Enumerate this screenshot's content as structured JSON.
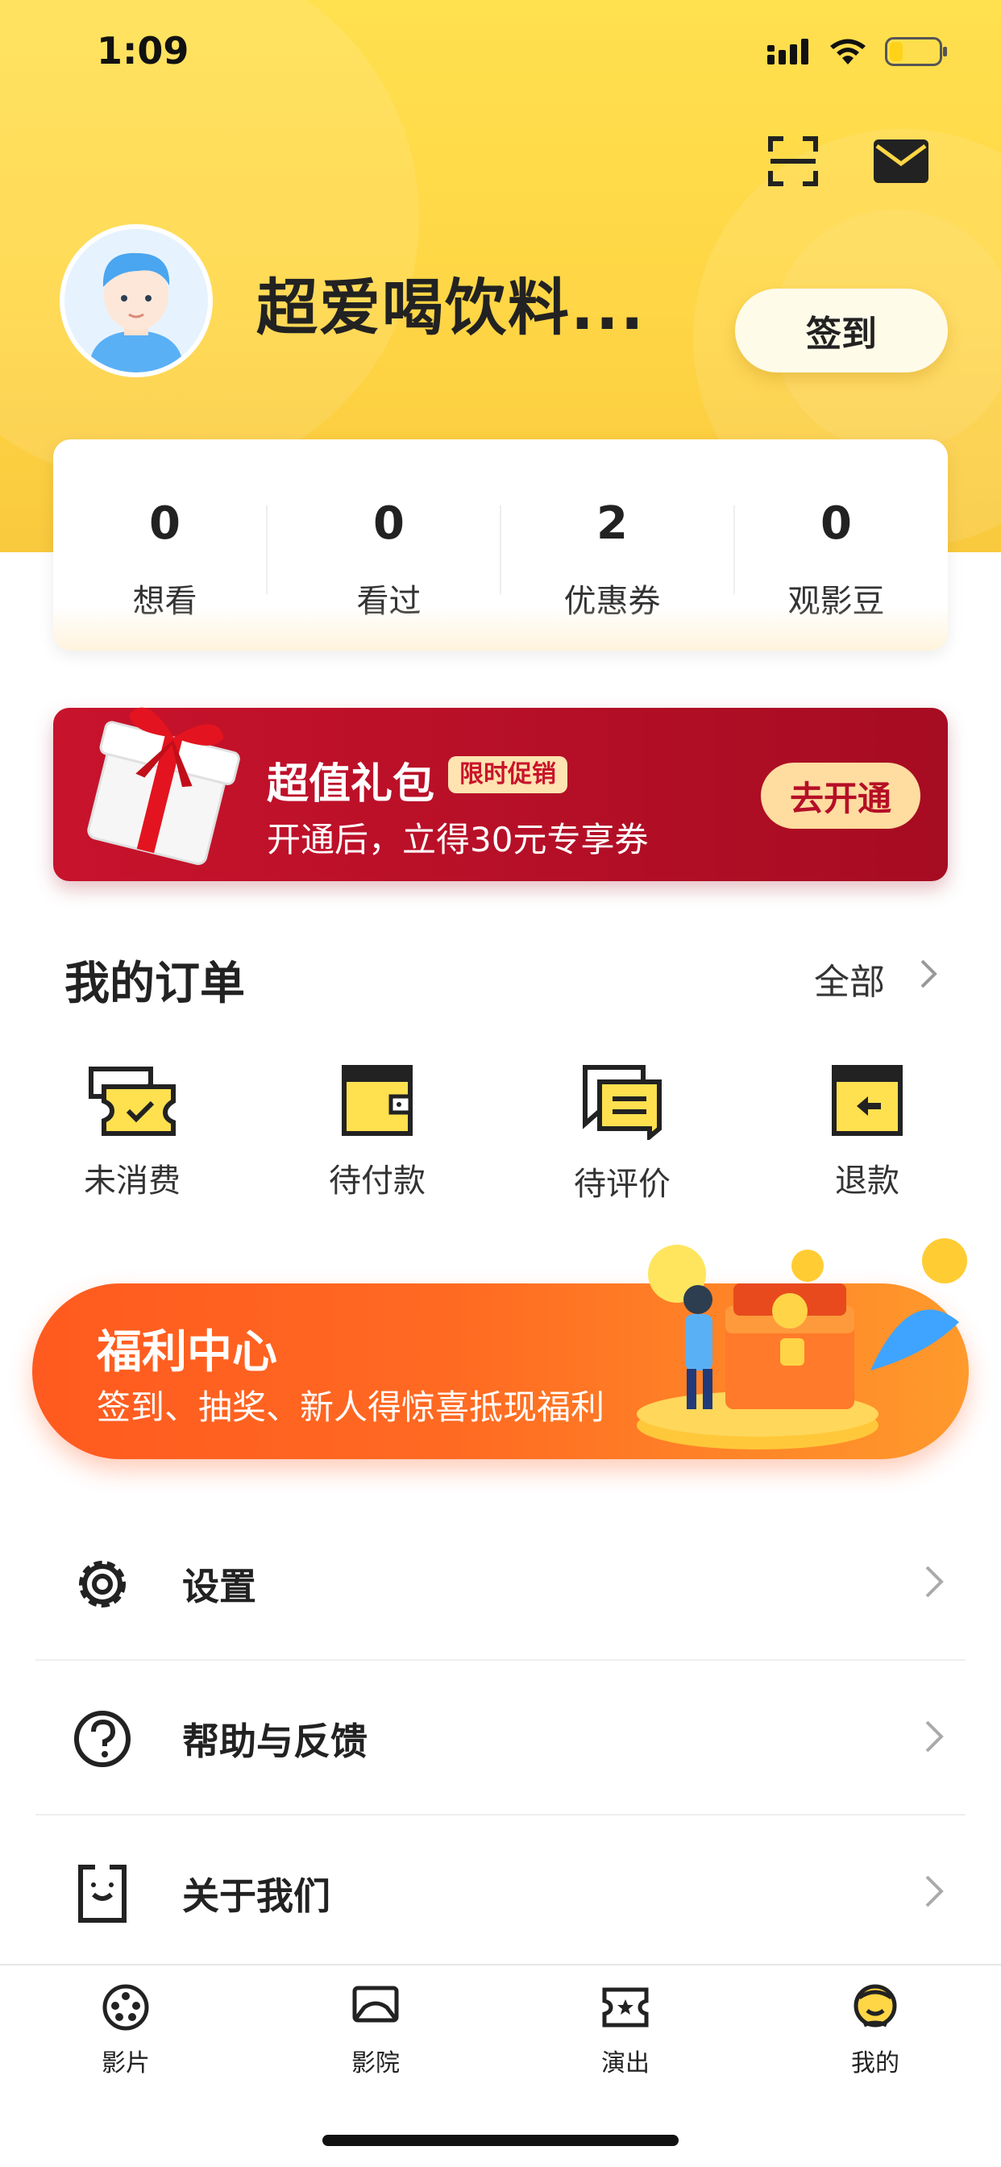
{
  "status_bar": {
    "time": "1:09"
  },
  "profile": {
    "username": "超爱喝饮料...",
    "signin_label": "签到"
  },
  "stats": [
    {
      "value": "0",
      "label": "想看"
    },
    {
      "value": "0",
      "label": "看过"
    },
    {
      "value": "2",
      "label": "优惠券"
    },
    {
      "value": "0",
      "label": "观影豆"
    }
  ],
  "promo": {
    "title": "超值礼包",
    "tag": "限时促销",
    "subtitle": "开通后，立得30元专享券",
    "button": "去开通"
  },
  "orders": {
    "title": "我的订单",
    "see_all": "全部",
    "items": [
      {
        "label": "未消费",
        "icon": "ticket-check-icon"
      },
      {
        "label": "待付款",
        "icon": "wallet-icon"
      },
      {
        "label": "待评价",
        "icon": "comment-icon"
      },
      {
        "label": "退款",
        "icon": "refund-icon"
      }
    ]
  },
  "welfare": {
    "title": "福利中心",
    "subtitle": "签到、抽奖、新人得惊喜抵现福利"
  },
  "menu": [
    {
      "label": "设置",
      "icon": "gear-icon"
    },
    {
      "label": "帮助与反馈",
      "icon": "help-icon"
    },
    {
      "label": "关于我们",
      "icon": "about-icon"
    }
  ],
  "tabbar": [
    {
      "label": "影片",
      "icon": "film-reel-icon"
    },
    {
      "label": "影院",
      "icon": "cinema-icon"
    },
    {
      "label": "演出",
      "icon": "show-ticket-icon"
    },
    {
      "label": "我的",
      "icon": "profile-icon"
    }
  ],
  "colors": {
    "header_yellow": "#ffd645",
    "promo_red": "#c8132c",
    "welfare_orange": "#ff6a22",
    "icon_yellow": "#ffe04f"
  }
}
